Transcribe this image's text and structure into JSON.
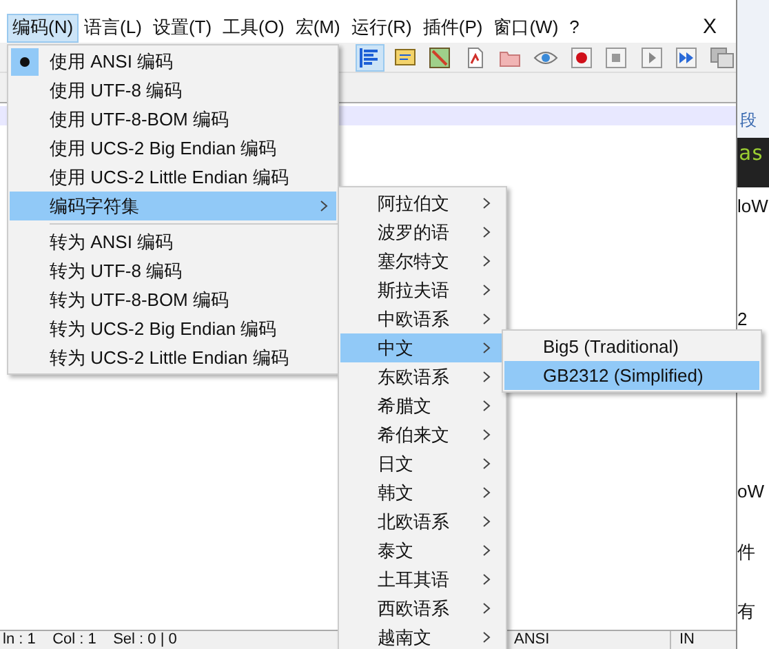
{
  "menu_bar": [
    {
      "label": "编码(N)",
      "selected": true
    },
    {
      "label": "语言(L)",
      "selected": false
    },
    {
      "label": "设置(T)",
      "selected": false
    },
    {
      "label": "工具(O)",
      "selected": false
    },
    {
      "label": "宏(M)",
      "selected": false
    },
    {
      "label": "运行(R)",
      "selected": false
    },
    {
      "label": "插件(P)",
      "selected": false
    },
    {
      "label": "窗口(W)",
      "selected": false
    },
    {
      "label": "?",
      "selected": false
    }
  ],
  "close_label": "X",
  "toolbar": [
    {
      "kind": "lines",
      "selected": true
    },
    {
      "kind": "note",
      "selected": false
    },
    {
      "kind": "map",
      "selected": false
    },
    {
      "kind": "doc",
      "selected": false
    },
    {
      "kind": "folder",
      "selected": false
    },
    {
      "kind": "eye",
      "selected": false
    },
    {
      "kind": "record",
      "selected": false
    },
    {
      "kind": "stop",
      "selected": false
    },
    {
      "kind": "play",
      "selected": false
    },
    {
      "kind": "fastforward",
      "selected": false
    },
    {
      "kind": "save",
      "selected": false
    }
  ],
  "encoding_menu": [
    {
      "kind": "item",
      "label": "使用 ANSI 编码",
      "checked": true,
      "selected": false,
      "submenu": false
    },
    {
      "kind": "item",
      "label": "使用 UTF-8 编码",
      "checked": false,
      "selected": false,
      "submenu": false
    },
    {
      "kind": "item",
      "label": "使用 UTF-8-BOM 编码",
      "checked": false,
      "selected": false,
      "submenu": false
    },
    {
      "kind": "item",
      "label": "使用 UCS-2 Big Endian 编码",
      "checked": false,
      "selected": false,
      "submenu": false
    },
    {
      "kind": "item",
      "label": "使用 UCS-2 Little Endian 编码",
      "checked": false,
      "selected": false,
      "submenu": false
    },
    {
      "kind": "item",
      "label": "编码字符集",
      "checked": false,
      "selected": true,
      "submenu": true
    },
    {
      "kind": "separator"
    },
    {
      "kind": "item",
      "label": "转为 ANSI 编码",
      "checked": false,
      "selected": false,
      "submenu": false
    },
    {
      "kind": "item",
      "label": "转为 UTF-8 编码",
      "checked": false,
      "selected": false,
      "submenu": false
    },
    {
      "kind": "item",
      "label": "转为 UTF-8-BOM 编码",
      "checked": false,
      "selected": false,
      "submenu": false
    },
    {
      "kind": "item",
      "label": "转为 UCS-2 Big Endian 编码",
      "checked": false,
      "selected": false,
      "submenu": false
    },
    {
      "kind": "item",
      "label": "转为 UCS-2 Little Endian 编码",
      "checked": false,
      "selected": false,
      "submenu": false
    }
  ],
  "charset_menu": [
    {
      "label": "阿拉伯文",
      "selected": false
    },
    {
      "label": "波罗的语",
      "selected": false
    },
    {
      "label": "塞尔特文",
      "selected": false
    },
    {
      "label": "斯拉夫语",
      "selected": false
    },
    {
      "label": "中欧语系",
      "selected": false
    },
    {
      "label": "中文",
      "selected": true
    },
    {
      "label": "东欧语系",
      "selected": false
    },
    {
      "label": "希腊文",
      "selected": false
    },
    {
      "label": "希伯来文",
      "selected": false
    },
    {
      "label": "日文",
      "selected": false
    },
    {
      "label": "韩文",
      "selected": false
    },
    {
      "label": "北欧语系",
      "selected": false
    },
    {
      "label": "泰文",
      "selected": false
    },
    {
      "label": "土耳其语",
      "selected": false
    },
    {
      "label": "西欧语系",
      "selected": false
    },
    {
      "label": "越南文",
      "selected": false
    }
  ],
  "chinese_menu": [
    {
      "label": "Big5 (Traditional)",
      "selected": false
    },
    {
      "label": "GB2312 (Simplified)",
      "selected": true
    }
  ],
  "status_bar": {
    "position": "ln : 1    Col : 1    Sel : 0 | 0",
    "encoding": "ANSI",
    "mode": "IN"
  },
  "background_window": {
    "ribbon_label": "段",
    "code_text": "as",
    "lines": [
      "loW",
      "2",
      "oW",
      "件",
      "有"
    ]
  }
}
